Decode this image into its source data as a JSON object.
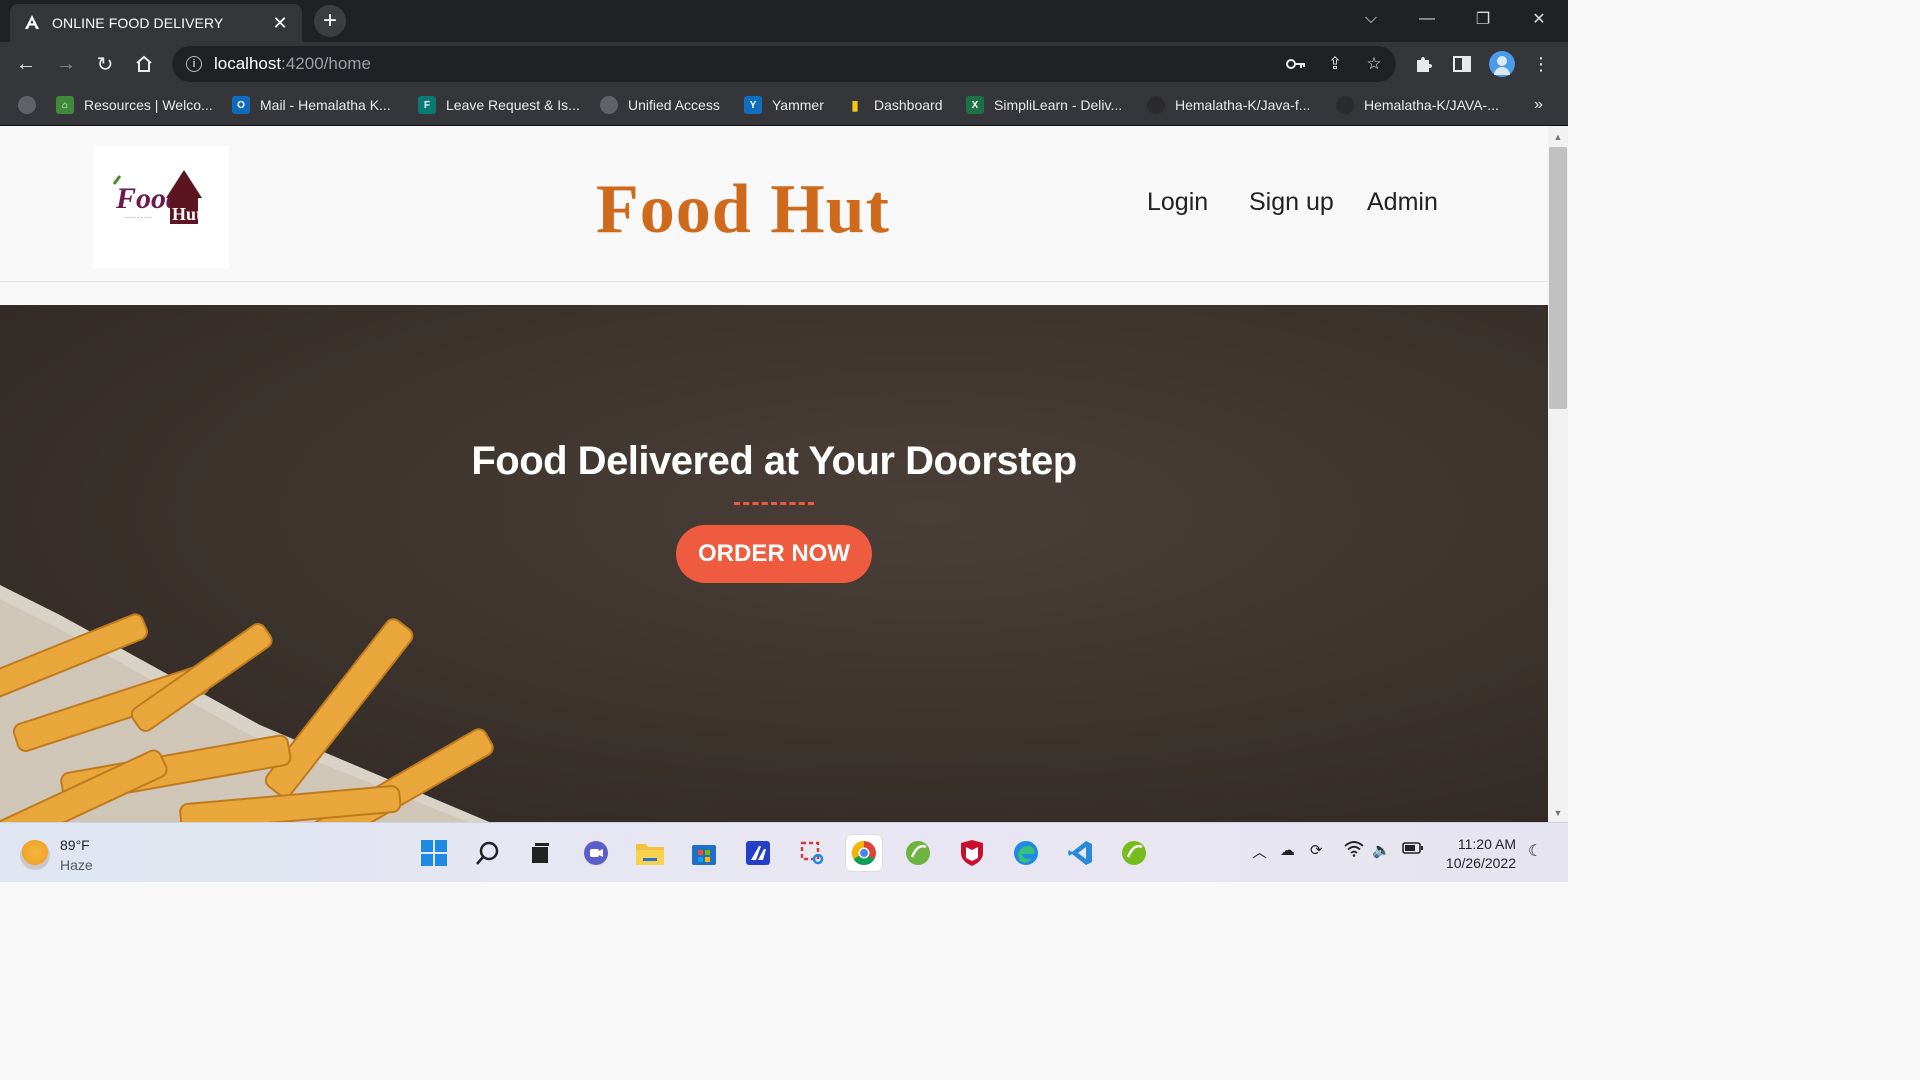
{
  "browser": {
    "tab_title": "ONLINE FOOD DELIVERY",
    "tab_favicon": "A",
    "url_host": "localhost",
    "url_path": ":4200/home",
    "bookmarks": [
      {
        "label": "Resources | Welco..."
      },
      {
        "label": "Mail - Hemalatha K..."
      },
      {
        "label": "Leave Request & Is..."
      },
      {
        "label": "Unified Access"
      },
      {
        "label": "Yammer"
      },
      {
        "label": "Dashboard"
      },
      {
        "label": "SimpliLearn - Deliv..."
      },
      {
        "label": "Hemalatha-K/Java-f..."
      },
      {
        "label": "Hemalatha-K/JAVA-..."
      }
    ],
    "more_bookmarks": "»"
  },
  "header": {
    "logo_text": "Food Hut",
    "title": "Food Hut",
    "nav": [
      "Login",
      "Sign up",
      "Admin"
    ]
  },
  "hero": {
    "title": "Food Delivered at Your Doorstep",
    "button": "ORDER NOW",
    "accent_color": "#ef5b3e"
  },
  "taskbar": {
    "weather_temp": "89°F",
    "weather_desc": "Haze",
    "time": "11:20 AM",
    "date": "10/26/2022"
  },
  "colors": {
    "title": "#cf6a1c",
    "hero_bg": "#3b322c"
  }
}
